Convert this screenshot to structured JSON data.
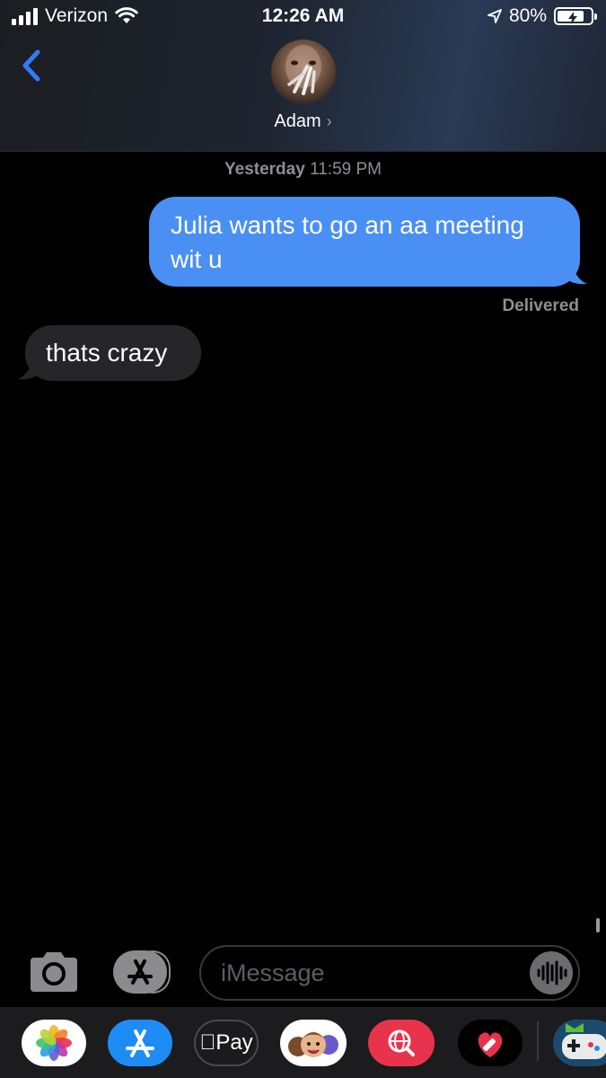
{
  "status_bar": {
    "carrier": "Verizon",
    "time": "12:26 AM",
    "battery": "80%",
    "battery_level": 0.8,
    "signal_bars": 4
  },
  "header": {
    "contact_name": "Adam",
    "contact_chevron": "›"
  },
  "conversation": {
    "timestamp_day": "Yesterday",
    "timestamp_time": "11:59 PM",
    "messages": [
      {
        "direction": "outgoing",
        "text": "Julia wants to go an aa meeting wit u"
      },
      {
        "direction": "incoming",
        "text": "thats crazy"
      }
    ],
    "delivered_label": "Delivered"
  },
  "input_bar": {
    "placeholder": "iMessage"
  },
  "app_drawer": {
    "apple_pay_label": "Pay",
    "icons": [
      "photos-icon",
      "app-store-icon",
      "apple-pay-icon",
      "memoji-icon",
      "web-search-icon",
      "digital-touch-icon",
      "game-app-icon"
    ]
  },
  "colors": {
    "outgoing_bubble": "#4a8ff3",
    "incoming_bubble": "#26262a",
    "back_chevron": "#2f7cf6",
    "app_store_blue": "#1e8cf5",
    "search_red": "#e8334c"
  }
}
